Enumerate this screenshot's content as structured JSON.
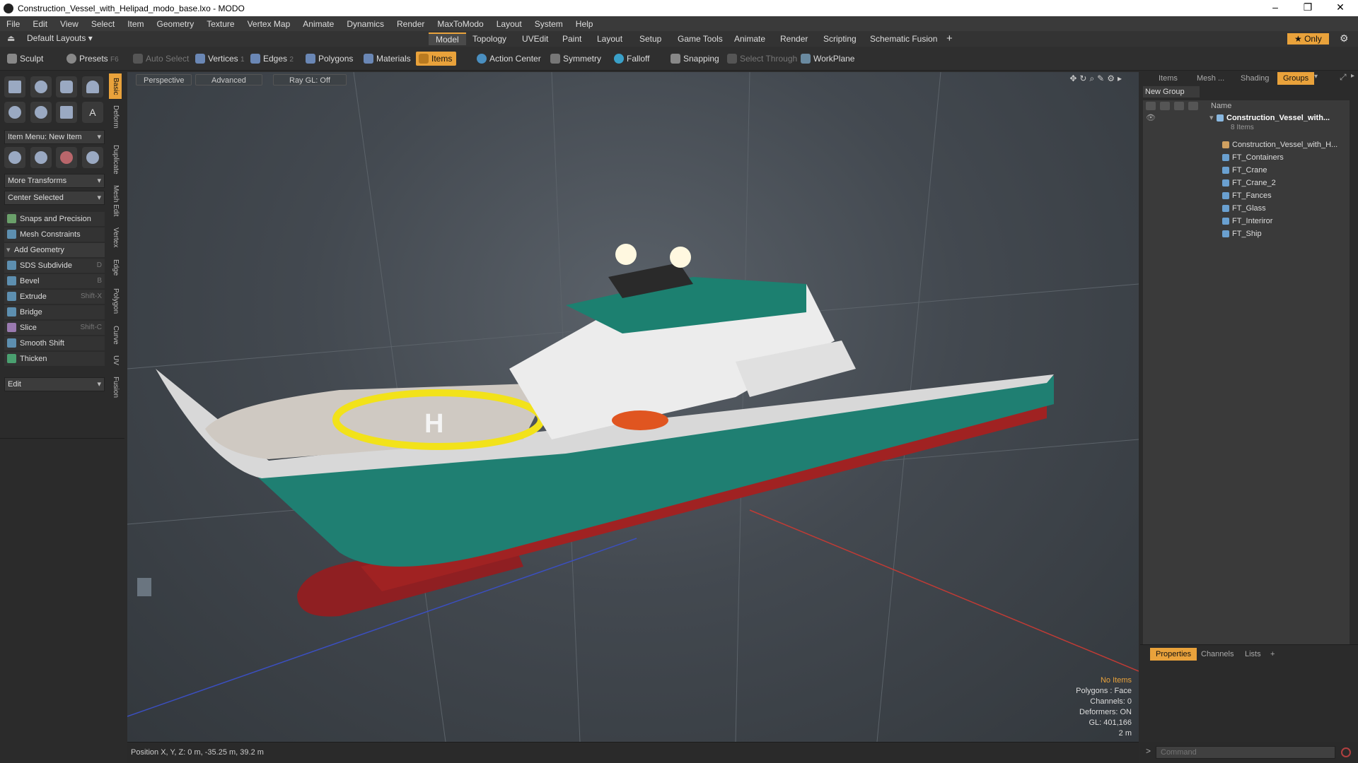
{
  "window": {
    "title": "Construction_Vessel_with_Helipad_modo_base.lxo - MODO",
    "minimize": "–",
    "restore": "❐",
    "close": "✕"
  },
  "menu": [
    "File",
    "Edit",
    "View",
    "Select",
    "Item",
    "Geometry",
    "Texture",
    "Vertex Map",
    "Animate",
    "Dynamics",
    "Render",
    "MaxToModo",
    "Layout",
    "System",
    "Help"
  ],
  "layouts": {
    "label": "Default Layouts ▾"
  },
  "tabs": [
    "Model",
    "Topology",
    "UVEdit",
    "Paint",
    "Layout",
    "Setup",
    "Game Tools",
    "Animate",
    "Render",
    "Scripting",
    "Schematic Fusion"
  ],
  "tabs_plus": "+",
  "only": "★  Only",
  "toolbar": {
    "sculpt": "Sculpt",
    "presets": "Presets",
    "presets_key": "F6",
    "auto_select": "Auto Select",
    "vertices": "Vertices",
    "vertices_count": "1",
    "edges": "Edges",
    "edges_count": "2",
    "polygons": "Polygons",
    "materials": "Materials",
    "items": "Items",
    "action_center": "Action Center",
    "symmetry": "Symmetry",
    "falloff": "Falloff",
    "snapping": "Snapping",
    "select_through": "Select Through",
    "workplane": "WorkPlane"
  },
  "left": {
    "item_menu": "Item Menu: New Item",
    "more_transforms": "More Transforms",
    "center_selected": "Center Selected",
    "snaps": "Snaps and Precision",
    "mesh_constraints": "Mesh Constraints",
    "add_geometry": "Add Geometry",
    "tools": [
      {
        "label": "SDS Subdivide",
        "key": "D"
      },
      {
        "label": "Bevel",
        "key": "B"
      },
      {
        "label": "Extrude",
        "key": "Shift-X"
      },
      {
        "label": "Bridge",
        "key": ""
      },
      {
        "label": "Slice",
        "key": "Shift-C"
      },
      {
        "label": "Smooth Shift",
        "key": ""
      },
      {
        "label": "Thicken",
        "key": ""
      }
    ],
    "edit": "Edit",
    "vtabs": [
      "Basic",
      "Deform",
      "Duplicate",
      "Mesh Edit",
      "Vertex",
      "Edge",
      "Polygon",
      "Curve",
      "UV",
      "Fusion"
    ]
  },
  "viewport": {
    "perspective": "Perspective",
    "advanced": "Advanced",
    "raygl": "Ray GL: Off",
    "info": {
      "items": "No Items",
      "polygons": "Polygons : Face",
      "channels": "Channels: 0",
      "deformers": "Deformers: ON",
      "gl": "GL: 401,166",
      "scale": "2 m"
    },
    "heli_letter": "H"
  },
  "status": {
    "position": "Position X, Y, Z:  0 m, -35.25 m, 39.2 m"
  },
  "right": {
    "tabs": [
      "Items",
      "Mesh ...",
      "Shading",
      "Groups"
    ],
    "new_group": "New Group",
    "col_name": "Name",
    "group_name": "Construction_Vessel_with...",
    "group_count": "8 Items",
    "children": [
      "Construction_Vessel_with_H...",
      "FT_Containers",
      "FT_Crane",
      "FT_Crane_2",
      "FT_Fances",
      "FT_Glass",
      "FT_Interiror",
      "FT_Ship"
    ],
    "bottom_tabs": [
      "Properties",
      "Channels",
      "Lists"
    ],
    "bottom_plus": "+",
    "command_placeholder": "Command",
    "command_prompt": ">"
  },
  "colors": {
    "accent": "#e9a23b",
    "hull_green": "#1f7f72",
    "hull_red": "#a02222",
    "helipad_yellow": "#f2e21a"
  }
}
